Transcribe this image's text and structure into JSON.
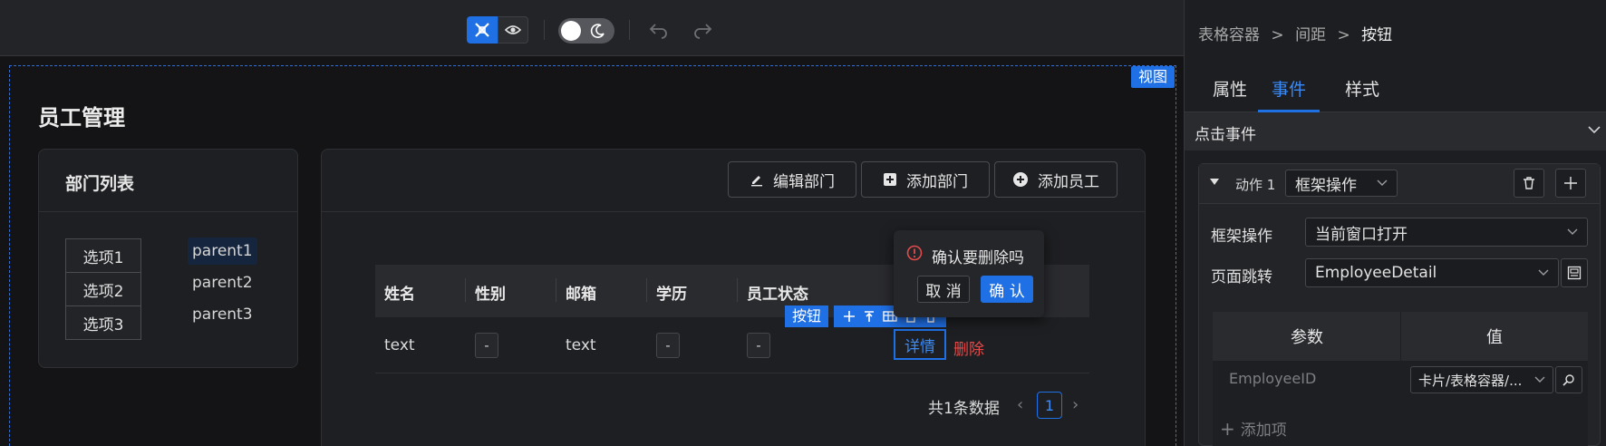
{
  "toolbar": {
    "design_icon": "design-mode-icon",
    "preview_icon": "preview-eye-icon",
    "theme_icon": "moon-icon",
    "undo_icon": "undo-icon",
    "redo_icon": "redo-icon"
  },
  "canvas": {
    "view_tag": "视图",
    "page_title": "员工管理",
    "dept_card": {
      "title": "部门列表",
      "options": [
        "选项1",
        "选项2",
        "选项3"
      ],
      "tree": [
        "parent1",
        "parent2",
        "parent3"
      ],
      "selected_tree_index": 0
    },
    "header_buttons": [
      {
        "label": "编辑部门",
        "icon": "edit-icon"
      },
      {
        "label": "添加部门",
        "icon": "plus-square-icon"
      },
      {
        "label": "添加员工",
        "icon": "plus-circle-icon"
      }
    ],
    "table": {
      "columns": [
        "姓名",
        "性别",
        "邮箱",
        "学历",
        "员工状态"
      ],
      "row": {
        "name": "text",
        "gender": "-",
        "email": "text",
        "education": "-",
        "status": "-"
      },
      "actions": {
        "detail": "详情",
        "delete": "删除"
      }
    },
    "selection": {
      "label": "按钮"
    },
    "popconfirm": {
      "message": "确认要删除吗",
      "cancel": "取 消",
      "ok": "确 认"
    },
    "pagination": {
      "total": "共1条数据",
      "current": "1"
    }
  },
  "panel": {
    "breadcrumb": {
      "items": [
        "表格容器",
        "间距"
      ],
      "current": "按钮",
      "sep": ">"
    },
    "tabs": [
      "属性",
      "事件",
      "样式"
    ],
    "active_tab": 1,
    "event_title": "点击事件",
    "action": {
      "label": "动作 1",
      "type": "框架操作",
      "frame_label": "框架操作",
      "frame_value": "当前窗口打开",
      "jump_label": "页面跳转",
      "jump_value": "EmployeeDetail",
      "param_headers": [
        "参数",
        "值"
      ],
      "param_name": "EmployeeID",
      "param_value": "卡片/表格容器/...",
      "add_item": "添加项"
    }
  },
  "colors": {
    "accent": "#1f6fe5",
    "danger": "#e24b4b",
    "bg": "#141416"
  }
}
